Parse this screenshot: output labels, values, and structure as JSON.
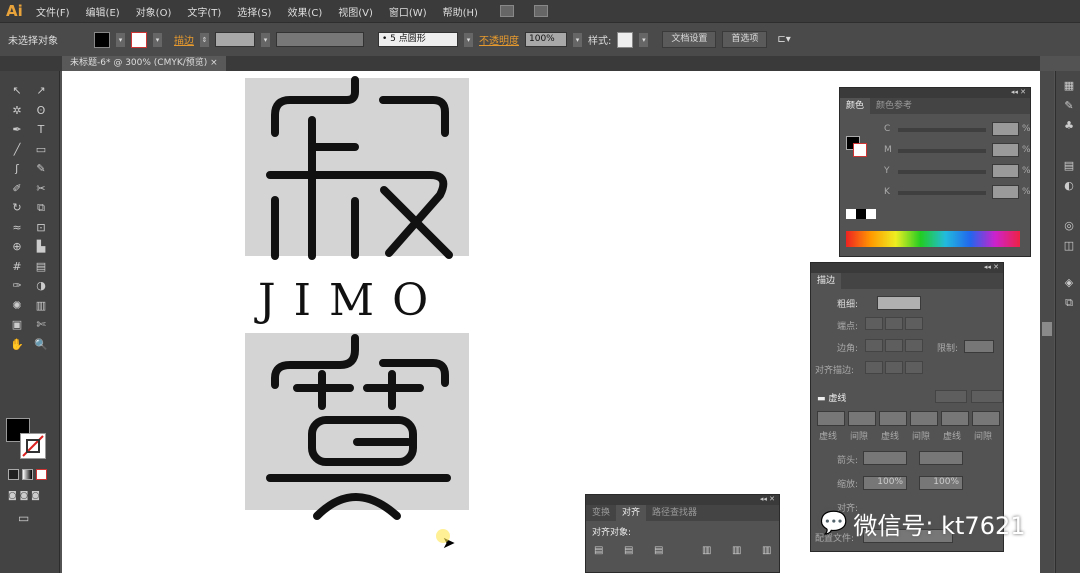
{
  "app": {
    "logo": "Ai"
  },
  "menu": [
    "文件(F)",
    "编辑(E)",
    "对象(O)",
    "文字(T)",
    "选择(S)",
    "效果(C)",
    "视图(V)",
    "窗口(W)",
    "帮助(H)"
  ],
  "control": {
    "selection": "未选择对象",
    "stroke_label": "描边",
    "brush": "• 5 点圆形",
    "opacity_label": "不透明度",
    "opacity": "100%",
    "style_label": "样式:",
    "doc_setup": "文档设置",
    "prefs": "首选项"
  },
  "document": {
    "tab": "未标题-6* @ 300% (CMYK/预览)",
    "close": "×"
  },
  "artwork": {
    "text": "JIMO",
    "bg_color": "#d4d4d4",
    "stroke_color": "#111111"
  },
  "color_panel": {
    "tabs": [
      "颜色",
      "颜色参考"
    ],
    "channels": [
      "C",
      "M",
      "Y",
      "K"
    ],
    "unit": "%"
  },
  "stroke_panel": {
    "title": "描边",
    "weight": "粗细:",
    "cap": "端点:",
    "corner": "边角:",
    "limit": "限制:",
    "align": "对齐描边:",
    "dashed": "虚线",
    "dash_labels": [
      "虚线",
      "间隙",
      "虚线",
      "间隙",
      "虚线",
      "间隙"
    ],
    "arrow": "箭头:",
    "scale": "缩放:",
    "scale_values": [
      "100%",
      "100%"
    ],
    "align2": "对齐:",
    "profile": "配置文件:"
  },
  "align_panel": {
    "tabs": [
      "变换",
      "对齐",
      "路径查找器"
    ],
    "label": "对齐对象:"
  },
  "watermark": "微信号: kt7621"
}
